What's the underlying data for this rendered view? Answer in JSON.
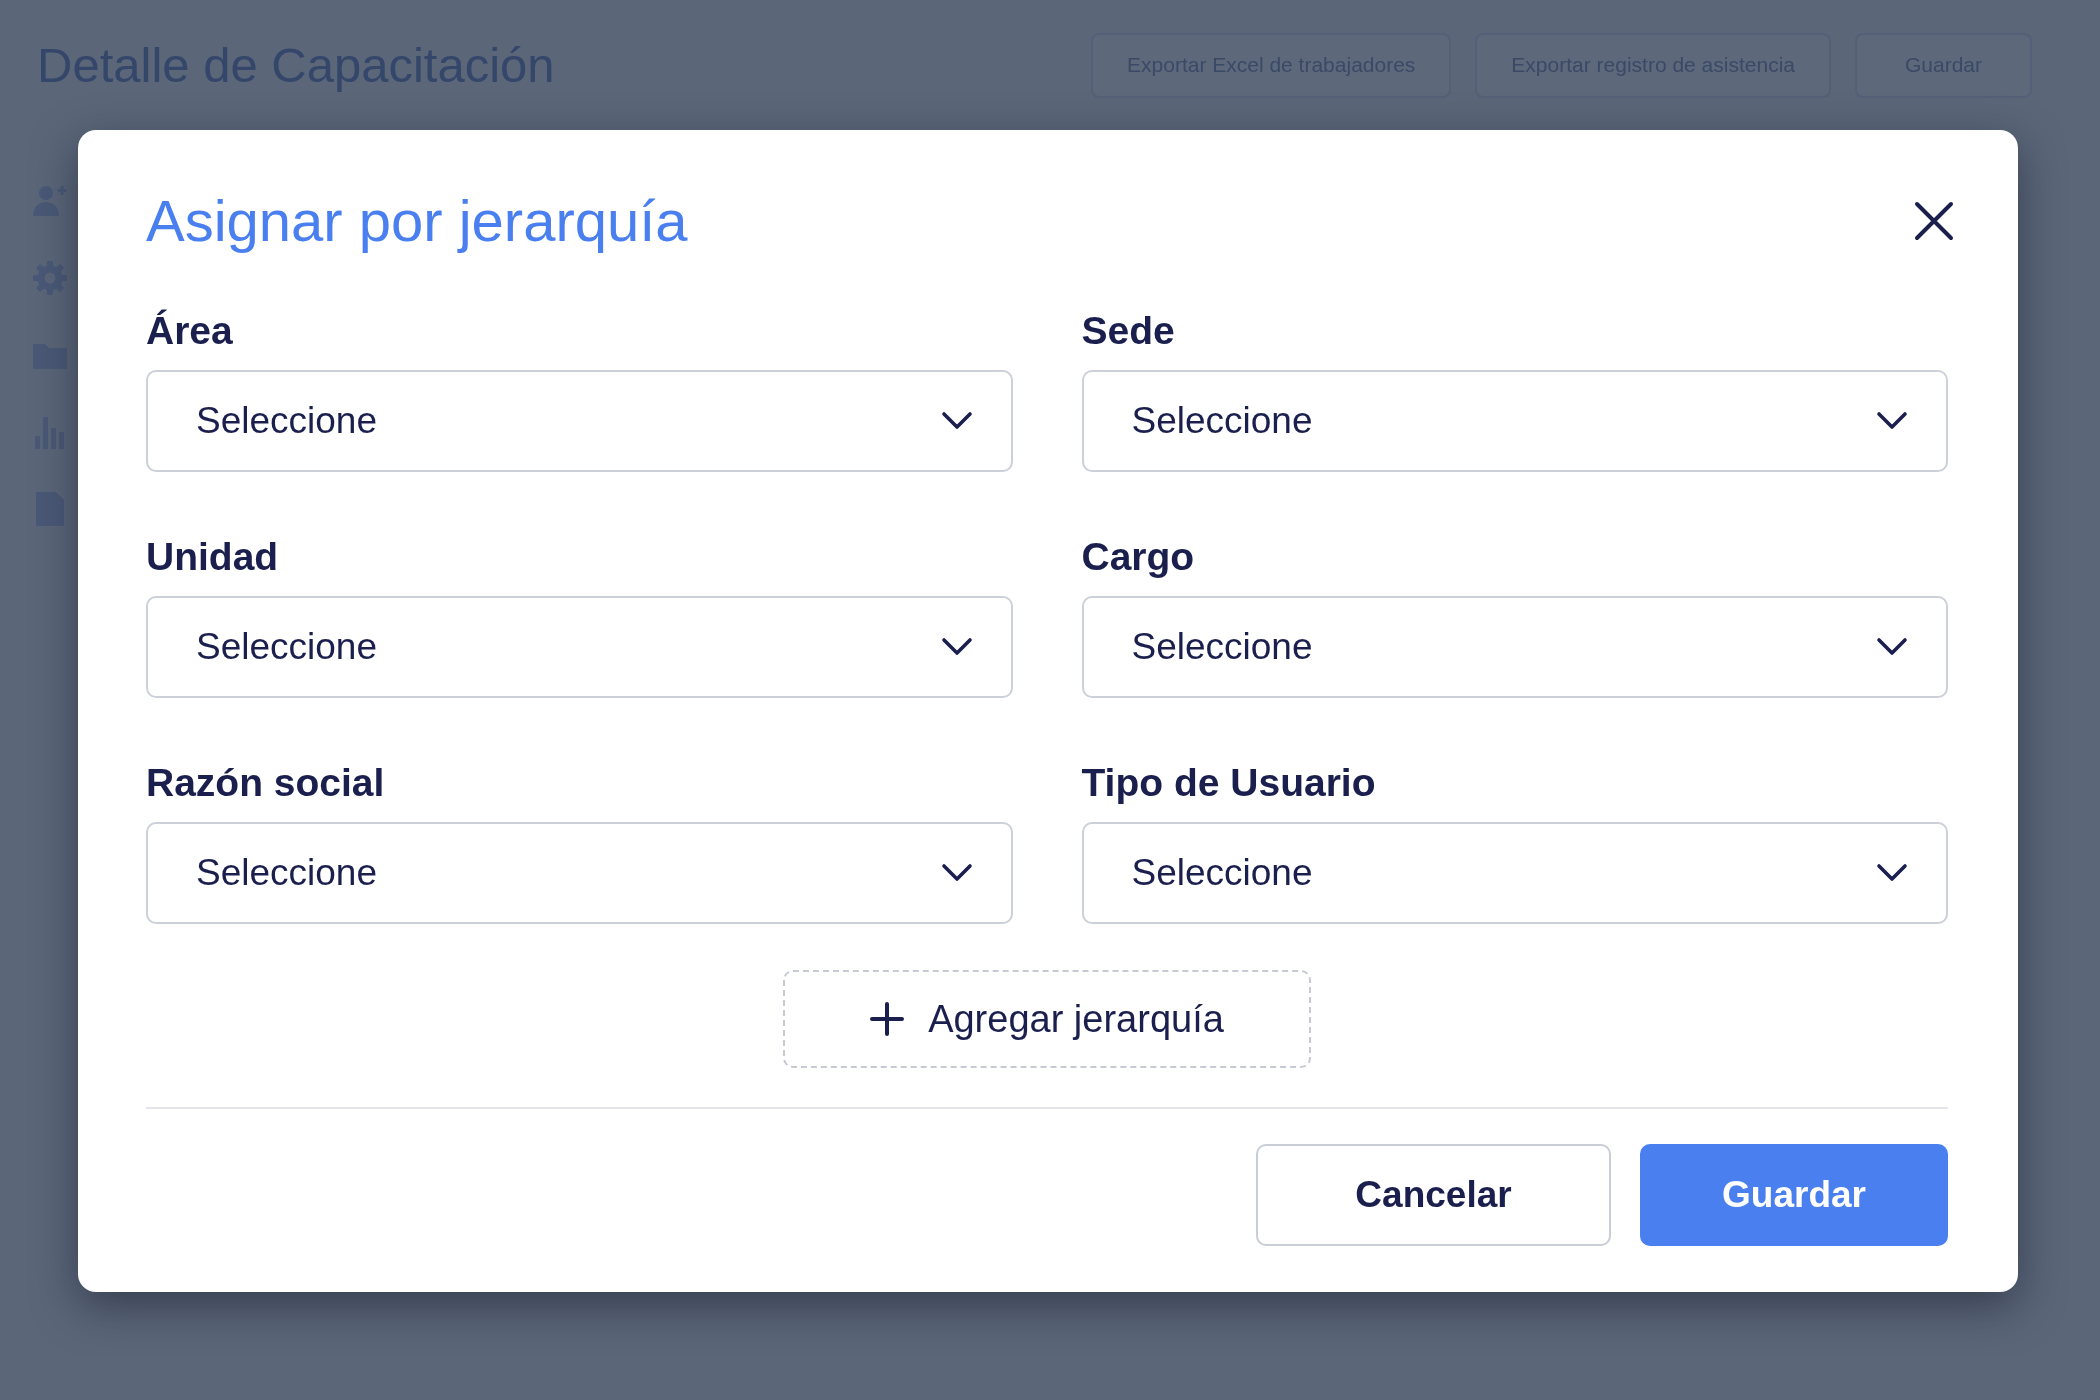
{
  "page": {
    "title": "Detalle de Capacitación",
    "actions": [
      "Exportar Excel de trabajadores",
      "Exportar registro de asistencia",
      "Guardar"
    ]
  },
  "dialog": {
    "title": "Asignar por jerarquía",
    "fields": [
      {
        "label": "Área",
        "placeholder": "Seleccione"
      },
      {
        "label": "Sede",
        "placeholder": "Seleccione"
      },
      {
        "label": "Unidad",
        "placeholder": "Seleccione"
      },
      {
        "label": "Cargo",
        "placeholder": "Seleccione"
      },
      {
        "label": "Razón social",
        "placeholder": "Seleccione"
      },
      {
        "label": "Tipo de Usuario",
        "placeholder": "Seleccione"
      }
    ],
    "add_button": {
      "label": "Agregar jerarquía"
    },
    "buttons": [
      {
        "label": "Cancelar",
        "kind": "secondary"
      },
      {
        "label": "Guardar",
        "kind": "primary"
      }
    ]
  }
}
